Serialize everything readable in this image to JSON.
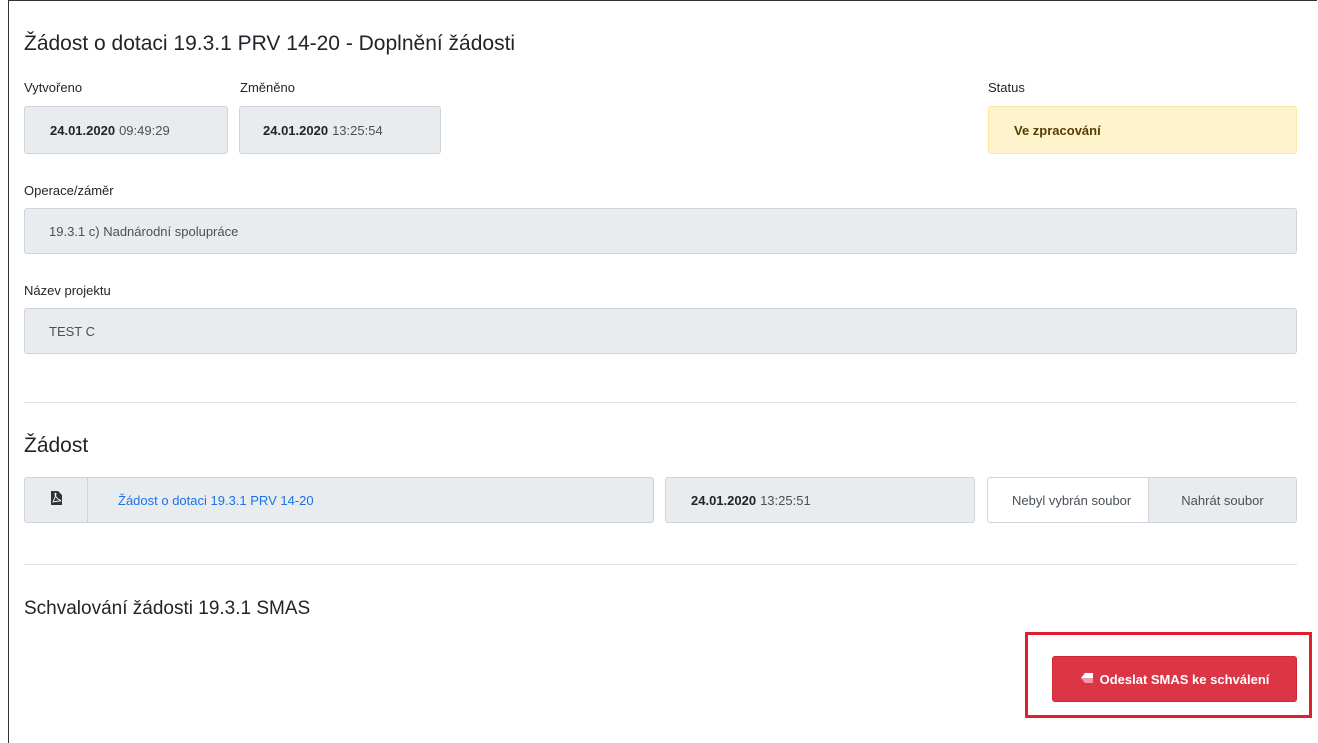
{
  "header": {
    "title": "Žádost o dotaci 19.3.1 PRV 14-20 - Doplnění žádosti"
  },
  "meta": {
    "created_label": "Vytvořeno",
    "created_date": "24.01.2020",
    "created_time": "09:49:29",
    "changed_label": "Změněno",
    "changed_date": "24.01.2020",
    "changed_time": "13:25:54",
    "status_label": "Status",
    "status_value": "Ve zpracování"
  },
  "operation": {
    "label": "Operace/záměr",
    "value": "19.3.1 c) Nadnárodní spolupráce"
  },
  "project": {
    "label": "Název projektu",
    "value": "TEST C"
  },
  "request": {
    "title": "Žádost",
    "file_icon": "file-pdf-icon",
    "file_link": "Žádost o dotaci 19.3.1 PRV 14-20",
    "file_date": "24.01.2020",
    "file_time": "13:25:51",
    "upload_placeholder": "Nebyl vybrán soubor",
    "upload_button": "Nahrát soubor"
  },
  "approval": {
    "title": "Schvalování žádosti 19.3.1 SMAS",
    "send_icon": "eraser-icon",
    "send_button": "Odeslat SMAS ke schválení",
    "highlight_color": "#e0202e",
    "button_color": "#dc3545"
  }
}
